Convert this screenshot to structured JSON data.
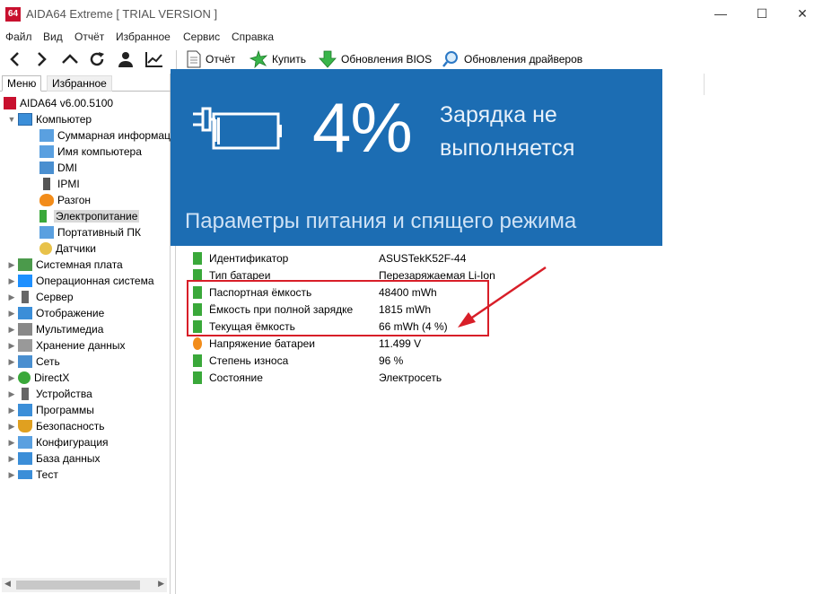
{
  "window": {
    "logo": "64",
    "title": "AIDA64 Extreme  [ TRIAL VERSION ]",
    "minimize": "—",
    "maximize": "☐",
    "close": "✕"
  },
  "menu": [
    "Файл",
    "Вид",
    "Отчёт",
    "Избранное",
    "Сервис",
    "Справка"
  ],
  "toolbar": {
    "report": "Отчёт",
    "buy": "Купить",
    "bios_update": "Обновления BIOS",
    "driver_update": "Обновления драйверов"
  },
  "left_tabs": {
    "menu": "Меню",
    "favorites": "Избранное"
  },
  "tree": {
    "root": "AIDA64 v6.00.5100",
    "computer": "Компьютер",
    "computer_children": [
      "Суммарная информация",
      "Имя компьютера",
      "DMI",
      "IPMI",
      "Разгон",
      "Электропитание",
      "Портативный ПК",
      "Датчики"
    ],
    "top_level": [
      "Системная плата",
      "Операционная система",
      "Сервер",
      "Отображение",
      "Мультимедиа",
      "Хранение данных",
      "Сеть",
      "DirectX",
      "Устройства",
      "Программы",
      "Безопасность",
      "Конфигурация",
      "База данных",
      "Тест"
    ]
  },
  "battery_rows": [
    {
      "field": "Идентификатор",
      "value": "ASUSTekK52F-44"
    },
    {
      "field": "Тип батареи",
      "value": "Перезаряжаемая Li-Ion"
    },
    {
      "field": "Паспортная ёмкость",
      "value": "48400 mWh"
    },
    {
      "field": "Ёмкость при полной зарядке",
      "value": "1815 mWh"
    },
    {
      "field": "Текущая ёмкость",
      "value": "66 mWh  (4 %)"
    },
    {
      "field": "Напряжение батареи",
      "value": "11.499 V"
    },
    {
      "field": "Степень износа",
      "value": "96 %"
    },
    {
      "field": "Состояние",
      "value": "Электросеть"
    }
  ],
  "popup": {
    "percent": "4%",
    "status": "Зарядка не выполняется",
    "footer": "Параметры питания и спящего режима",
    "level_percent": 4
  },
  "colors": {
    "popup_bg": "#1c6db3",
    "highlight": "#d81e28",
    "battery_green": "#3aa83a",
    "logo_red": "#c8102e"
  }
}
